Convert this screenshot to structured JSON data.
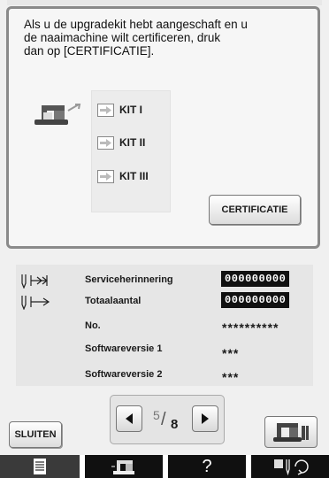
{
  "panel": {
    "message": "Als u de upgradekit hebt aangeschaft en u\nde naaimachine wilt certificeren, druk\ndan op [CERTIFICATIE].",
    "kits": [
      "KIT I",
      "KIT II",
      "KIT III"
    ],
    "certify_button": "CERTIFICATIE"
  },
  "info": {
    "rows": [
      {
        "label": "Serviceherinnering",
        "value": "000000000",
        "icon": "needle-arrows-icon"
      },
      {
        "label": "Totaalaantal",
        "value": "000000000",
        "icon": "needle-arrow-icon"
      },
      {
        "label": "No.",
        "value": "**********"
      },
      {
        "label": "Softwareversie 1",
        "value": "***"
      },
      {
        "label": "Softwareversie 2",
        "value": "***"
      }
    ]
  },
  "footer": {
    "close_button": "SLUITEN",
    "page_current": "5",
    "page_total": "8"
  },
  "tabs": [
    {
      "name": "settings-page-tab",
      "icon": "document-icon"
    },
    {
      "name": "machine-tab",
      "icon": "sewing-machine-icon"
    },
    {
      "name": "help-tab",
      "icon": "question-icon",
      "text": "?"
    },
    {
      "name": "needle-mode-tab",
      "icon": "needle-rotate-icon"
    }
  ],
  "colors": {
    "panel_border": "#8a8a8a",
    "bottom_bar": "#101010",
    "counter_bg": "#111111"
  }
}
